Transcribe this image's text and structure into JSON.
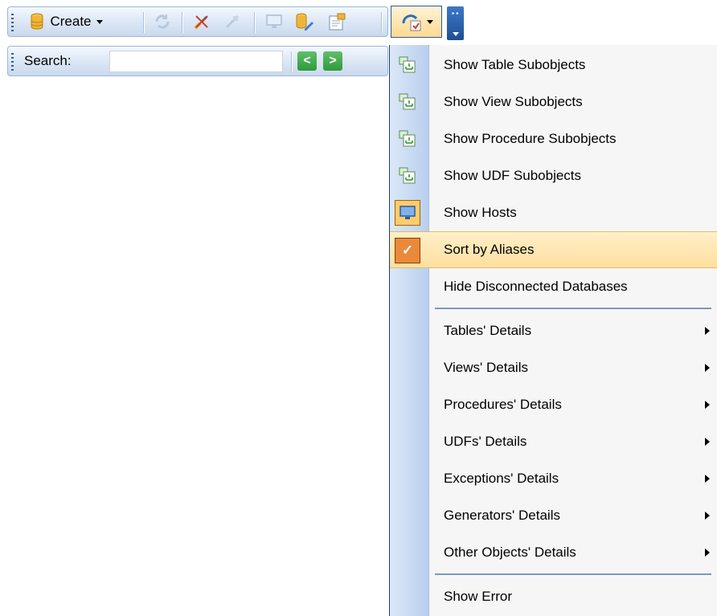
{
  "toolbar": {
    "create_label": "Create",
    "icons": [
      "database-icon",
      "refresh-icon",
      "disconnect-icon",
      "connect-icon",
      "host-icon",
      "db-edit-icon",
      "properties-icon"
    ]
  },
  "search": {
    "label": "Search:",
    "value": "",
    "prev_label": "<",
    "next_label": ">"
  },
  "menu": {
    "items": [
      {
        "label": "Show Table Subobjects",
        "icon": "subobjects-icon"
      },
      {
        "label": "Show View Subobjects",
        "icon": "subobjects-icon"
      },
      {
        "label": "Show Procedure Subobjects",
        "icon": "subobjects-icon"
      },
      {
        "label": "Show UDF Subobjects",
        "icon": "subobjects-icon"
      },
      {
        "label": "Show Hosts",
        "icon": "host-icon",
        "checked": true
      },
      {
        "label": "Sort by Aliases",
        "icon": "check-icon",
        "checked": true,
        "highlighted": true
      },
      {
        "label": "Hide Disconnected Databases"
      },
      {
        "label": "Tables' Details",
        "submenu": true
      },
      {
        "label": "Views' Details",
        "submenu": true
      },
      {
        "label": "Procedures' Details",
        "submenu": true
      },
      {
        "label": "UDFs' Details",
        "submenu": true
      },
      {
        "label": "Exceptions' Details",
        "submenu": true
      },
      {
        "label": "Generators' Details",
        "submenu": true
      },
      {
        "label": "Other Objects' Details",
        "submenu": true
      },
      {
        "label": "Show Error"
      }
    ]
  },
  "colors": {
    "highlight": "#ffdfa0",
    "check_bg": "#e98a3a",
    "toolbar_bg": "#dfe9f6",
    "gutter": "#b8cfee"
  }
}
